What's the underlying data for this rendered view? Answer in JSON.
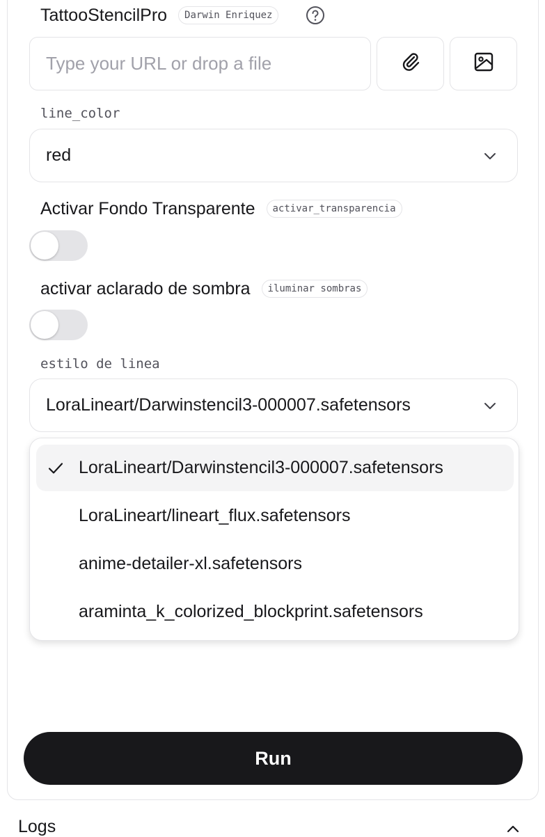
{
  "app": {
    "title": "TattooStencilPro",
    "author": "Darwin Enriquez"
  },
  "upload": {
    "placeholder": "Type your URL or drop a file",
    "icons": [
      "paperclip-icon",
      "image-icon"
    ]
  },
  "line_color": {
    "label": "line_color",
    "value": "red"
  },
  "transparency": {
    "label": "Activar Fondo Transparente",
    "param": "activar_transparencia",
    "on": false
  },
  "shadows": {
    "label": "activar aclarado de sombra",
    "param": "iluminar sombras",
    "on": false
  },
  "line_style": {
    "label": "estilo de linea",
    "value": "LoraLineart/Darwinstencil3-000007.safetensors",
    "options": [
      "LoraLineart/Darwinstencil3-000007.safetensors",
      "LoraLineart/lineart_flux.safetensors",
      "anime-detailer-xl.safetensors",
      "araminta_k_colorized_blockprint.safetensors"
    ]
  },
  "run_label": "Run",
  "logs_label": "Logs"
}
